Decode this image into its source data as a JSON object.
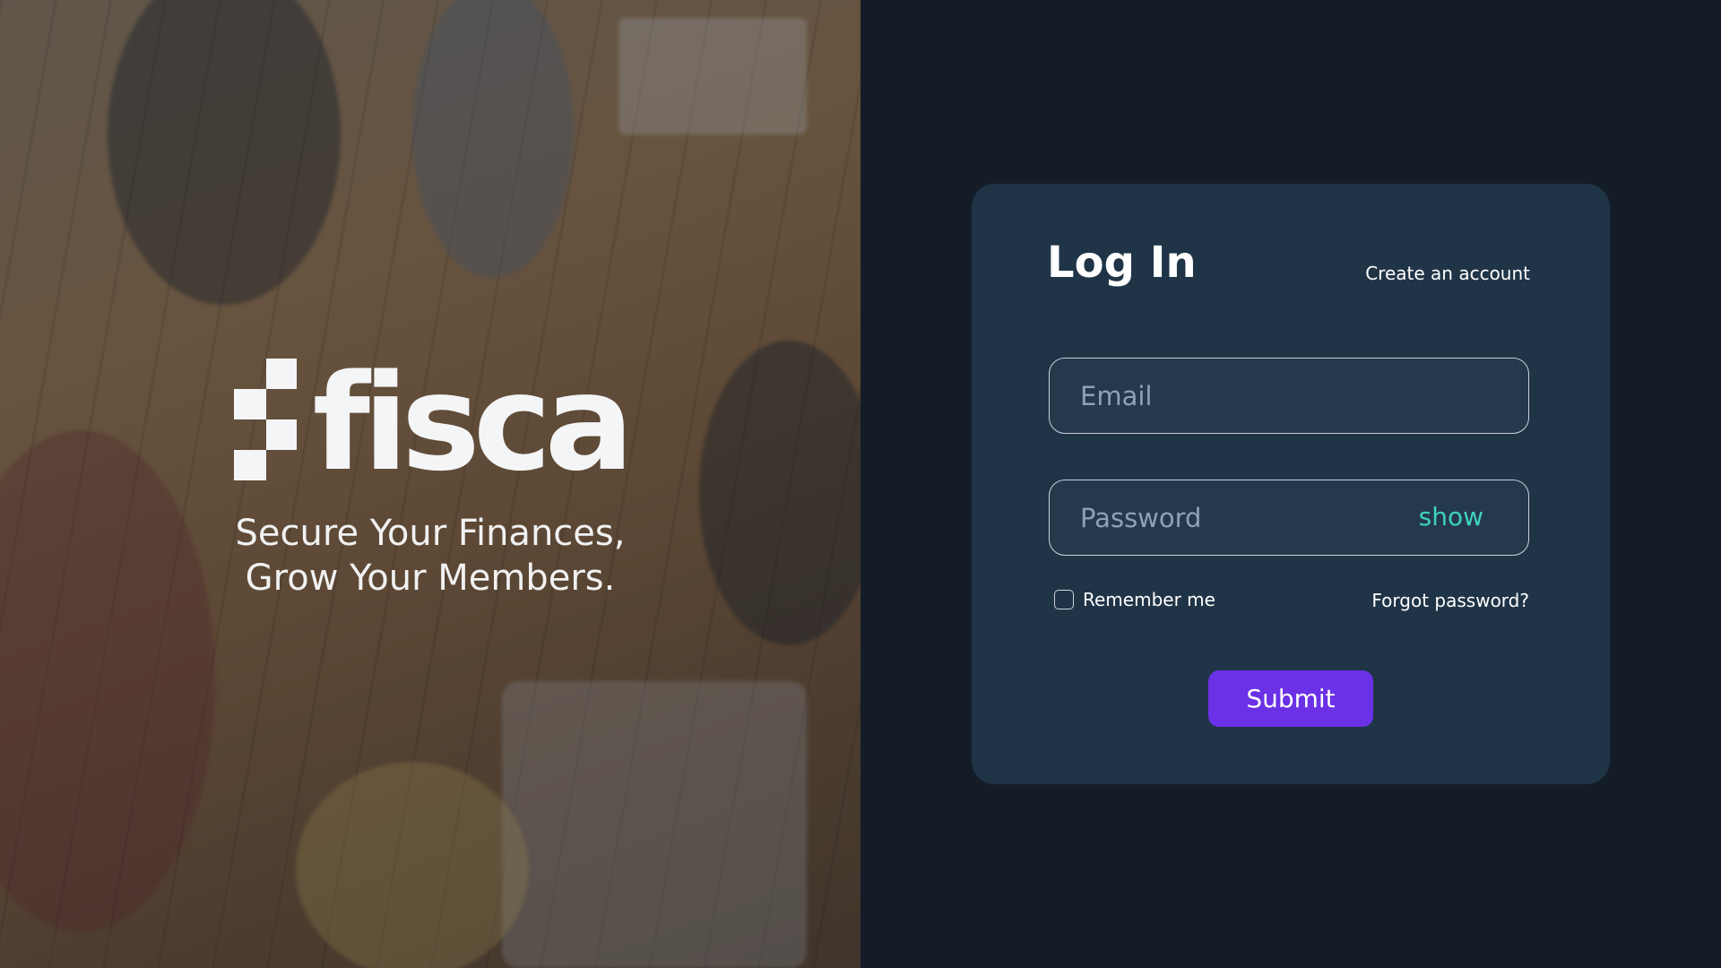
{
  "brand": {
    "name": "fisca",
    "tagline_line1": "Secure Your Finances,",
    "tagline_line2": "Grow Your Members."
  },
  "login": {
    "title": "Log In",
    "create_account": "Create an account",
    "email": {
      "placeholder": "Email",
      "value": ""
    },
    "password": {
      "placeholder": "Password",
      "value": "",
      "toggle": "show"
    },
    "remember_me": "Remember me",
    "remember_checked": false,
    "forgot_password": "Forgot password?",
    "submit": "Submit"
  },
  "colors": {
    "page_background": "#141d27",
    "card_background": "#203447",
    "accent_show": "#3fd2b8",
    "submit_button": "#6b31e6"
  },
  "icons": {
    "logo": "fisca-pixel-logo-icon"
  }
}
